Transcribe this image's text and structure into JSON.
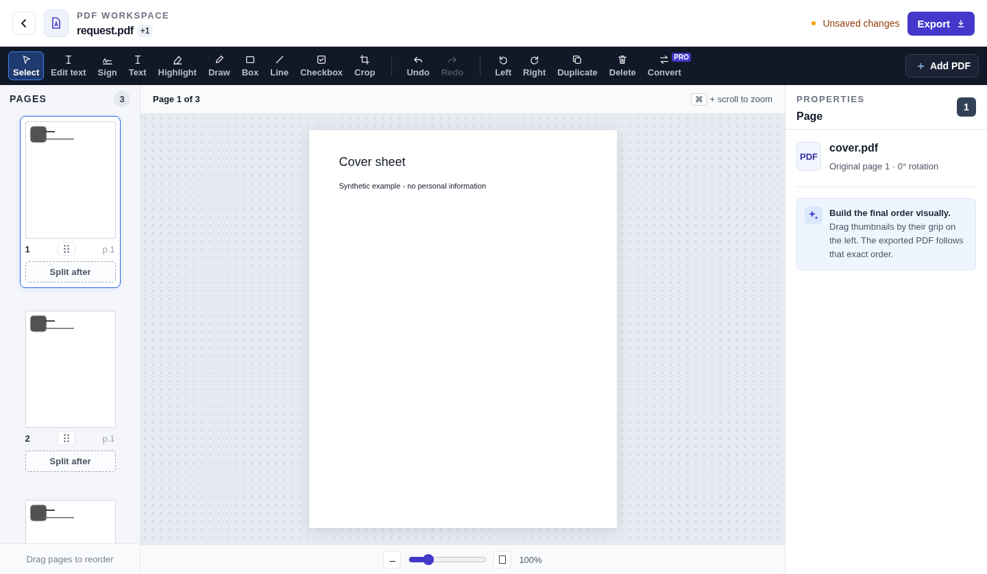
{
  "header": {
    "eyebrow": "PDF WORKSPACE",
    "file_name": "request.pdf",
    "extra_count": "+1",
    "status": "Unsaved changes",
    "export_label": "Export"
  },
  "tool_groups": [
    [
      {
        "label": "Select",
        "selected": true,
        "disabled": false
      },
      {
        "label": "Edit text",
        "selected": false,
        "disabled": false
      },
      {
        "label": "Sign",
        "selected": false,
        "disabled": false
      },
      {
        "label": "Text",
        "selected": false,
        "disabled": false
      },
      {
        "label": "Highlight",
        "selected": false,
        "disabled": false
      },
      {
        "label": "Draw",
        "selected": false,
        "disabled": false
      },
      {
        "label": "Box",
        "selected": false,
        "disabled": false
      },
      {
        "label": "Line",
        "selected": false,
        "disabled": false
      },
      {
        "label": "Checkbox",
        "selected": false,
        "disabled": false
      },
      {
        "label": "Crop",
        "selected": false,
        "disabled": false
      }
    ],
    [
      {
        "label": "Undo",
        "selected": false,
        "disabled": false
      },
      {
        "label": "Redo",
        "selected": false,
        "disabled": true
      }
    ],
    [
      {
        "label": "Left",
        "selected": false,
        "disabled": false
      },
      {
        "label": "Right",
        "selected": false,
        "disabled": false
      },
      {
        "label": "Duplicate",
        "selected": false,
        "disabled": false
      },
      {
        "label": "Delete",
        "selected": false,
        "disabled": false
      },
      {
        "label": "Convert",
        "selected": false,
        "disabled": false,
        "badge": "PRO"
      }
    ]
  ],
  "add_pdf_label": "Add PDF",
  "pages_panel": {
    "title": "PAGES",
    "count": "3",
    "footer": "Drag pages to reorder",
    "pages": [
      {
        "number": "1",
        "source_page": "p.1",
        "selected": true,
        "split_label": "Split after"
      },
      {
        "number": "2",
        "source_page": "p.1",
        "selected": false,
        "split_label": "Split after"
      },
      {
        "selected": false
      }
    ]
  },
  "canvas": {
    "page_indicator": "Page 1 of 3",
    "shortcut_key": "⌘",
    "shortcut_hint": "+ scroll to zoom",
    "document_title": "Cover sheet",
    "document_body": "Synthetic example - no personal information",
    "zoom": {
      "minus": "–",
      "level": 0.25,
      "reading": "100%"
    }
  },
  "properties": {
    "eyebrow": "PROPERTIES",
    "title": "Page",
    "page_badge": "1",
    "file_icon_label": "PDF",
    "file_name": "cover.pdf",
    "file_meta": "Original page 1 · 0° rotation",
    "tip": "**Build the final order visually.** Drag thumbnails by their grip on the left. The exported PDF follows that exact order."
  }
}
